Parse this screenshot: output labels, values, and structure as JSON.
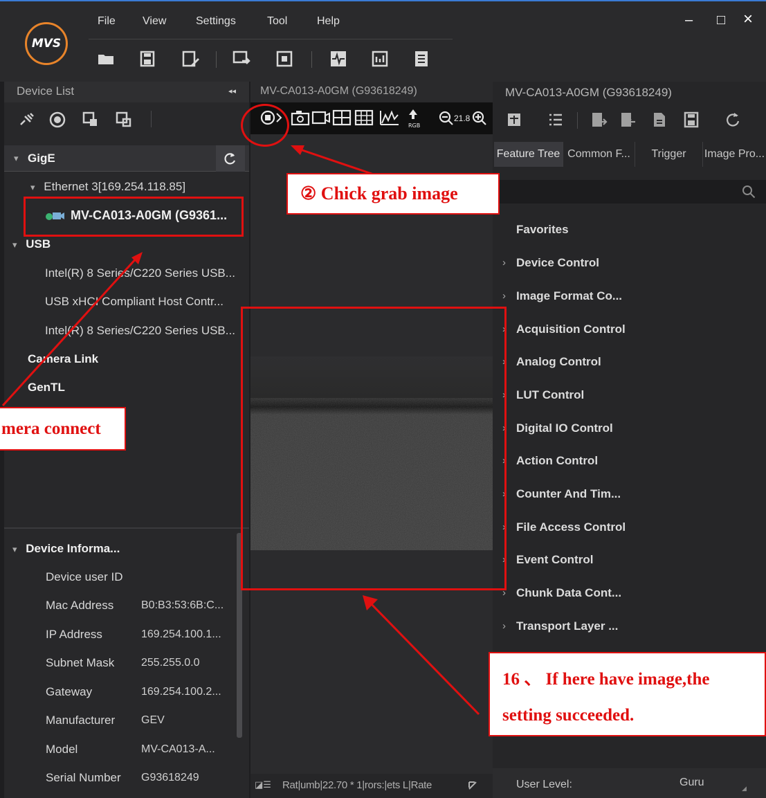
{
  "menu": {
    "file": "File",
    "view": "View",
    "settings": "Settings",
    "tool": "Tool",
    "help": "Help"
  },
  "logo_text": "MVS",
  "window_controls": {
    "minimize": "–",
    "maximize": "□",
    "close": "×"
  },
  "left_panel": {
    "title": "Device List",
    "collapse_glyph": "◂◂",
    "tree": {
      "gige": "GigE",
      "ethernet": "Ethernet 3[169.254.118.85]",
      "camera": "MV-CA013-A0GM (G9361...",
      "usb": "USB",
      "usb_items": [
        "Intel(R) 8 Series/C220 Series USB...",
        "USB xHCI Compliant Host Contr...",
        "Intel(R) 8 Series/C220 Series USB..."
      ],
      "camera_link": "Camera Link",
      "gentl": "GenTL"
    },
    "device_info": {
      "title": "Device Informa...",
      "rows": [
        {
          "label": "Device user ID",
          "value": ""
        },
        {
          "label": "Mac Address",
          "value": "B0:B3:53:6B:C..."
        },
        {
          "label": "IP Address",
          "value": "169.254.100.1..."
        },
        {
          "label": "Subnet Mask",
          "value": "255.255.0.0"
        },
        {
          "label": "Gateway",
          "value": "169.254.100.2..."
        },
        {
          "label": "Manufacturer",
          "value": "GEV"
        },
        {
          "label": "Model",
          "value": "MV-CA013-A..."
        },
        {
          "label": "Serial Number",
          "value": "G93618249"
        }
      ]
    }
  },
  "center": {
    "tab_title": "MV-CA013-A0GM (G93618249)",
    "zoom": "21.8",
    "status_text": "Rat|umb|22.70 * 1|rors:|ets L|Rate"
  },
  "right_panel": {
    "title": "MV-CA013-A0GM (G93618249)",
    "tabs": [
      "Feature Tree",
      "Common F...",
      "Trigger",
      "Image Pro..."
    ],
    "search_placeholder": "",
    "features": [
      {
        "label": "Favorites",
        "caret": ""
      },
      {
        "label": "Device Control",
        "caret": "›"
      },
      {
        "label": "Image Format Co...",
        "caret": "›"
      },
      {
        "label": "Acquisition Control",
        "caret": "›"
      },
      {
        "label": "Analog Control",
        "caret": "›"
      },
      {
        "label": "LUT Control",
        "caret": "›"
      },
      {
        "label": "Digital IO Control",
        "caret": "›"
      },
      {
        "label": "Action Control",
        "caret": "›"
      },
      {
        "label": "Counter And Tim...",
        "caret": "›"
      },
      {
        "label": "File Access Control",
        "caret": "›"
      },
      {
        "label": "Event Control",
        "caret": "›"
      },
      {
        "label": "Chunk Data Cont...",
        "caret": "›"
      },
      {
        "label": "Transport Layer ...",
        "caret": "›"
      }
    ],
    "user_level_label": "User Level:",
    "user_level_value": "Guru"
  },
  "annotations": {
    "grab_image": "② Chick grab image",
    "camera_connect": "mera connect",
    "success_line1": "16 、 If here have image,the",
    "success_line2": "setting succeeded."
  },
  "colors": {
    "annotation_red": "#e01010",
    "accent_blue": "#3a7bd5",
    "camera_icon_green": "#3cb371"
  }
}
